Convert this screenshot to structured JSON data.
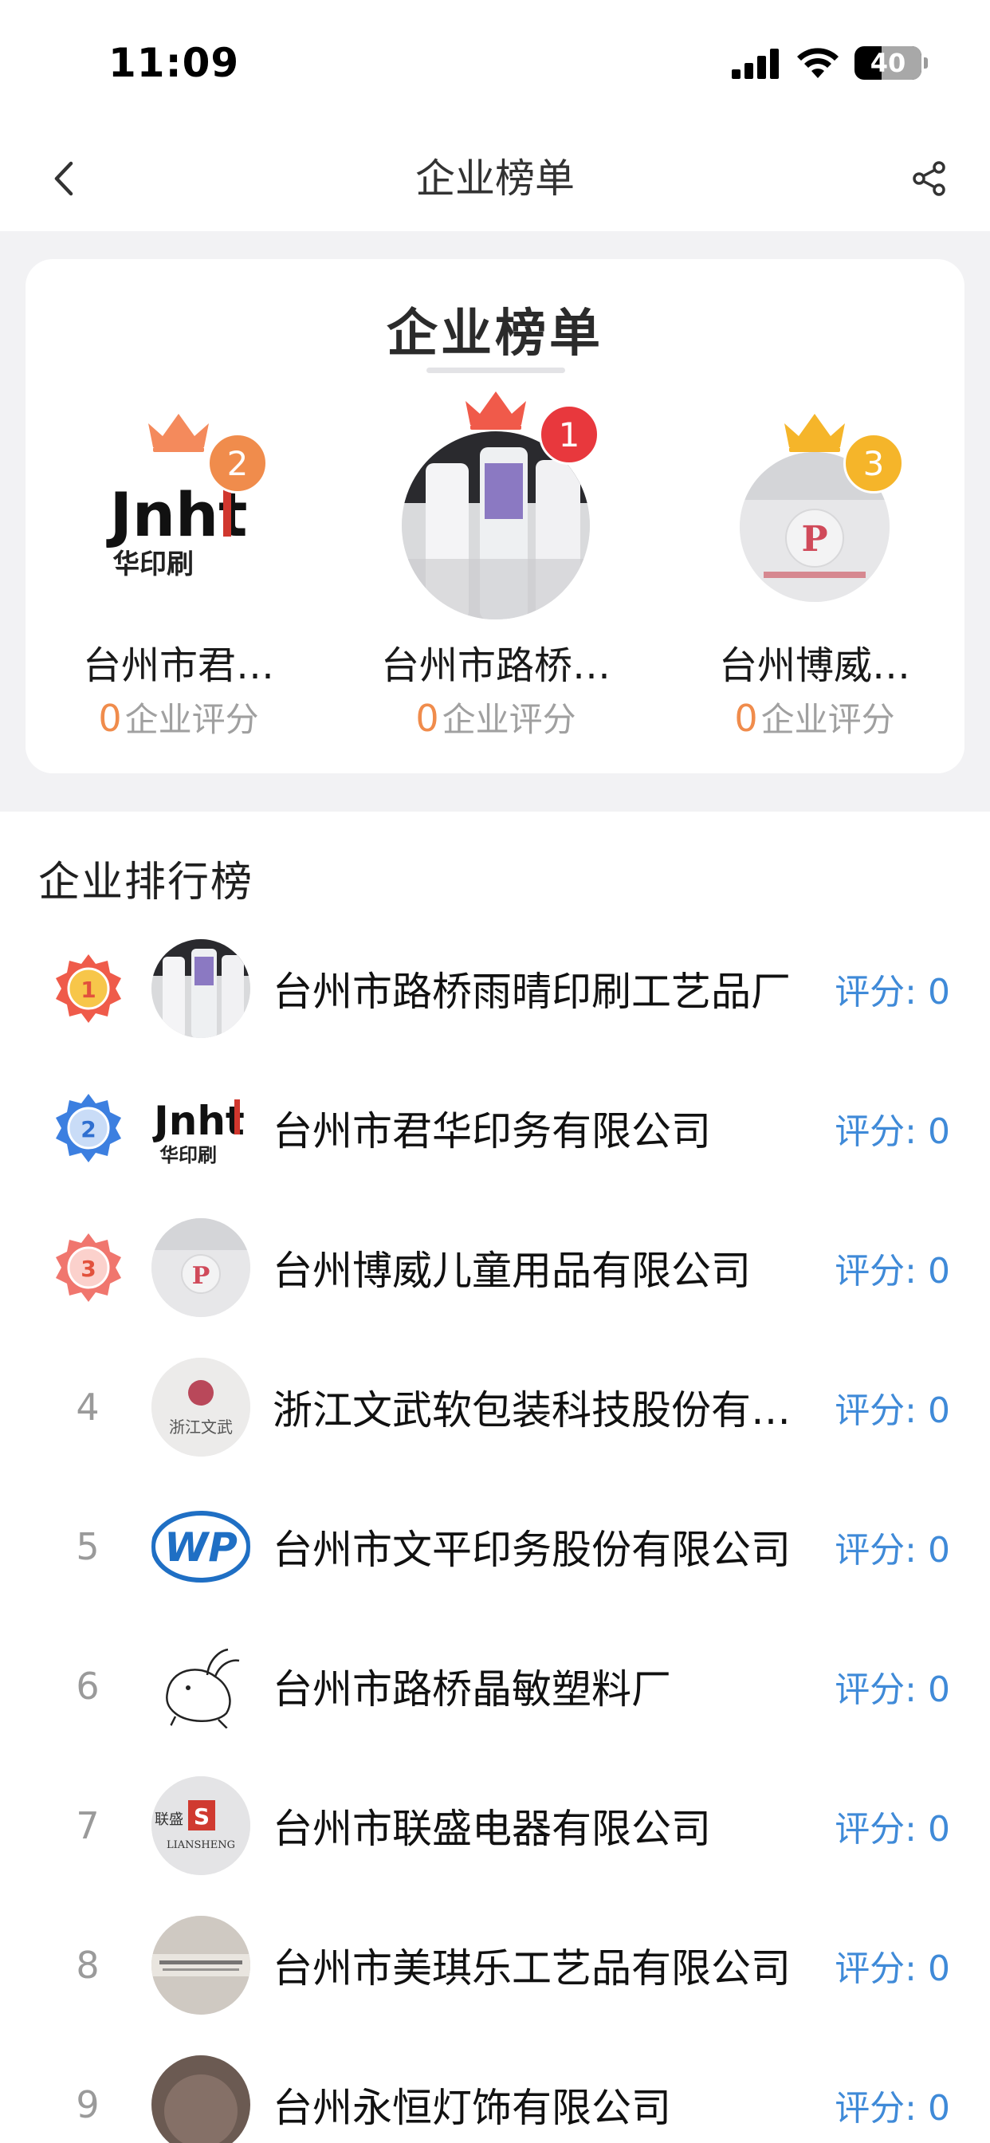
{
  "status": {
    "time": "11:09",
    "battery": "40",
    "battery_level": 0.4
  },
  "nav": {
    "title": "企业榜单"
  },
  "podium": {
    "title": "企业榜单",
    "items": [
      {
        "rank": "2",
        "name": "台州市君…",
        "score": "0",
        "score_label": "企业评分",
        "logo_text": "Jnht",
        "logo_sub": "华印刷",
        "crown_color": "#f48a5c",
        "badge_color": "#f08c4c"
      },
      {
        "rank": "1",
        "name": "台州市路桥…",
        "score": "0",
        "score_label": "企业评分",
        "crown_color": "#f05a4a",
        "badge_color": "#e8383d"
      },
      {
        "rank": "3",
        "name": "台州博威…",
        "score": "0",
        "score_label": "企业评分",
        "crown_color": "#f5b52a",
        "badge_color": "#f5b52a"
      }
    ]
  },
  "ranking": {
    "title": "企业排行榜",
    "score_prefix": "评分: ",
    "rows": [
      {
        "rank": "1",
        "name": "台州市路桥雨晴印刷工艺品厂",
        "score": "0"
      },
      {
        "rank": "2",
        "name": "台州市君华印务有限公司",
        "score": "0",
        "logo_text": "Jnht",
        "logo_sub": "华印刷"
      },
      {
        "rank": "3",
        "name": "台州博威儿童用品有限公司",
        "score": "0"
      },
      {
        "rank": "4",
        "name": "浙江文武软包装科技股份有限公司",
        "score": "0",
        "logo_sub": "浙江文武"
      },
      {
        "rank": "5",
        "name": "台州市文平印务股份有限公司",
        "score": "0",
        "logo_text": "WP"
      },
      {
        "rank": "6",
        "name": "台州市路桥晶敏塑料厂",
        "score": "0"
      },
      {
        "rank": "7",
        "name": "台州市联盛电器有限公司",
        "score": "0",
        "logo_sub": "联盛",
        "logo_en": "LIANSHENG"
      },
      {
        "rank": "8",
        "name": "台州市美琪乐工艺品有限公司",
        "score": "0"
      },
      {
        "rank": "9",
        "name": "台州永恒灯饰有限公司",
        "score": "0"
      }
    ]
  }
}
